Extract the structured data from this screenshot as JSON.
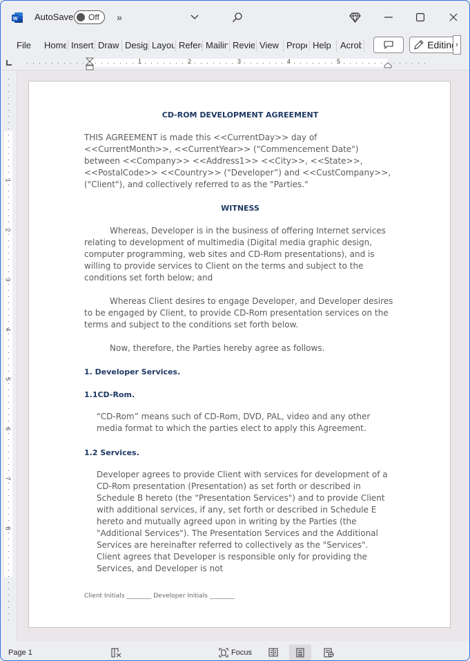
{
  "titlebar": {
    "autosave_label": "AutoSave",
    "autosave_state": "Off",
    "icons": [
      "word-logo-icon",
      "more-commands-icon",
      "customize-qat-chevron-icon",
      "search-icon",
      "premium-diamond-icon",
      "minimize-icon",
      "maximize-icon",
      "close-icon"
    ],
    "overflow_glyph": "»"
  },
  "ribbon": {
    "tabs": [
      {
        "label": "File"
      },
      {
        "label": "Home"
      },
      {
        "label": "Insert"
      },
      {
        "label": "Draw"
      },
      {
        "label": "Design"
      },
      {
        "label": "Layout"
      },
      {
        "label": "References"
      },
      {
        "label": "Mailings"
      },
      {
        "label": "Review"
      },
      {
        "label": "View"
      },
      {
        "label": "Properties"
      },
      {
        "label": "Help"
      },
      {
        "label": "Acrobat"
      }
    ],
    "comments_icon": "comment-icon",
    "editing_label": "Editing",
    "editing_icon": "pencil-icon",
    "more_glyph": "›"
  },
  "ruler": {
    "horizontal_numbers": [
      "1",
      "2",
      "3",
      "4",
      "5"
    ],
    "vertical_numbers": [
      "1",
      "2",
      "3",
      "4",
      "5",
      "6",
      "7",
      "8"
    ]
  },
  "document": {
    "title": "CD-ROM DEVELOPMENT AGREEMENT",
    "intro": "THIS AGREEMENT is made this <<CurrentDay>> day of <<CurrentMonth>>, <<CurrentYear>> (\"Commencement Date\") between <<Company>> <<Address1>> <<City>>, <<State>>, <<PostalCode>> <<Country>> (“Developer”) and <<CustCompany>>, (\"Client\"), and collectively referred to as the \"Parties.\"",
    "witness_heading": "WITNESS",
    "whereas_1": "Whereas, Developer is in the business of offering Internet services relating to development of multimedia (Digital media graphic design, computer programming, web sites and CD-Rom presentations), and is willing to provide services to Client on the terms and subject to the conditions set forth below; and",
    "whereas_2": "Whereas Client desires to engage Developer, and Developer desires to be engaged by Client, to provide CD-Rom presentation services on the terms and subject to the conditions set forth below.",
    "now_therefore": "Now, therefore, the Parties hereby agree as follows.",
    "section_1_heading": "1. Developer Services.",
    "section_1_1_heading": "1.1CD-Rom.",
    "section_1_1_body": "“CD-Rom” means such of CD-Rom, DVD, PAL, video and any other media format to which the parties elect to apply this Agreement.",
    "section_1_2_heading": "1.2 Services.",
    "section_1_2_body": "Developer agrees  to provide Client with services for development of a CD-Rom presentation (Presentation) as set forth or described in Schedule B hereto   (the “Presentation Services\") and to provide Client with additional services, if any, set forth or described in Schedule E hereto and mutually agreed upon in writing by the Parties (the \"Additional Services\"). The Presentation Services and the Additional Services are hereinafter referred to collectively as the \"Services\". Client agrees that Developer is responsible only for providing the Services, and Developer is not",
    "footer": "Client Initials  ________ Developer Initials ________"
  },
  "statusbar": {
    "page_label": "Page 1",
    "focus_label": "Focus",
    "view_modes": [
      "read-mode",
      "print-layout",
      "web-layout"
    ],
    "active_view": "print-layout"
  }
}
